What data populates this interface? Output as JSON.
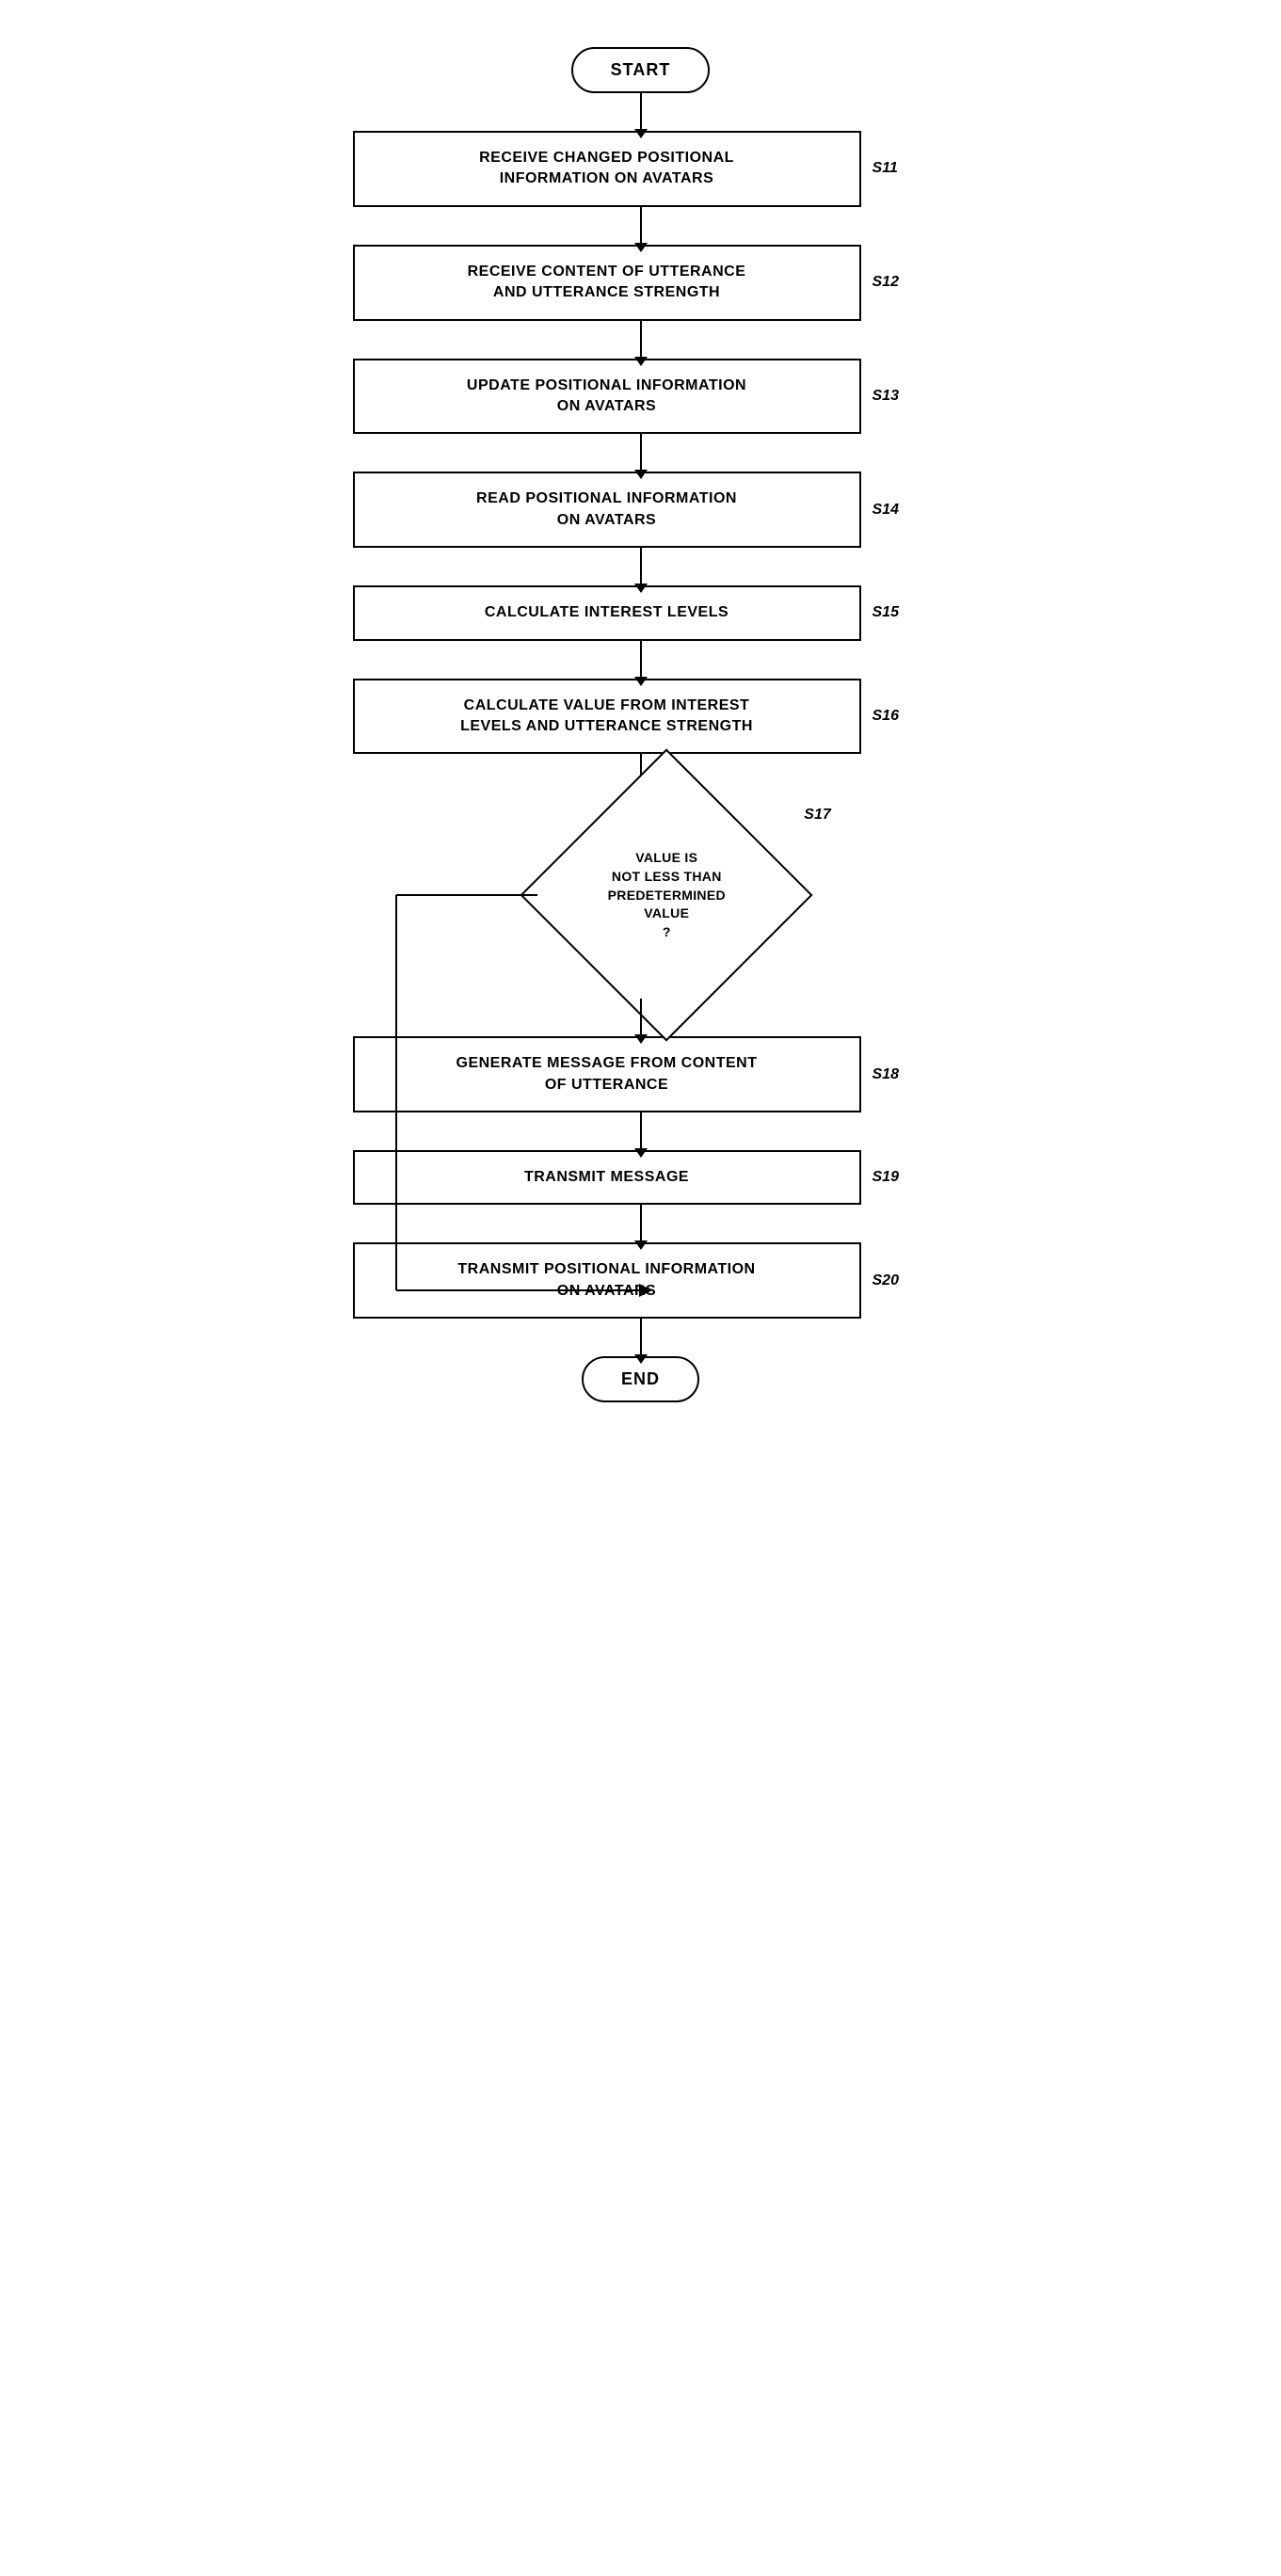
{
  "start_label": "START",
  "end_label": "END",
  "steps": [
    {
      "id": "s11",
      "label": "S11",
      "text": "RECEIVE CHANGED POSITIONAL\nINFORMATION ON AVATARS"
    },
    {
      "id": "s12",
      "label": "S12",
      "text": "RECEIVE CONTENT OF UTTERANCE\nAND UTTERANCE STRENGTH"
    },
    {
      "id": "s13",
      "label": "S13",
      "text": "UPDATE POSITIONAL INFORMATION\nON AVATARS"
    },
    {
      "id": "s14",
      "label": "S14",
      "text": "READ POSITIONAL INFORMATION\nON AVATARS"
    },
    {
      "id": "s15",
      "label": "S15",
      "text": "CALCULATE INTEREST LEVELS"
    },
    {
      "id": "s16",
      "label": "S16",
      "text": "CALCULATE VALUE FROM INTEREST\nLEVELS AND UTTERANCE STRENGTH"
    },
    {
      "id": "s17",
      "label": "S17",
      "text": "VALUE IS\nNOT LESS THAN\nPREDETERMINED\nVALUE\n?"
    },
    {
      "id": "s18",
      "label": "S18",
      "text": "GENERATE MESSAGE FROM CONTENT\nOF UTTERANCE"
    },
    {
      "id": "s19",
      "label": "S19",
      "text": "TRANSMIT MESSAGE"
    },
    {
      "id": "s20",
      "label": "S20",
      "text": "TRANSMIT POSITIONAL INFORMATION\nON AVATARS"
    }
  ]
}
